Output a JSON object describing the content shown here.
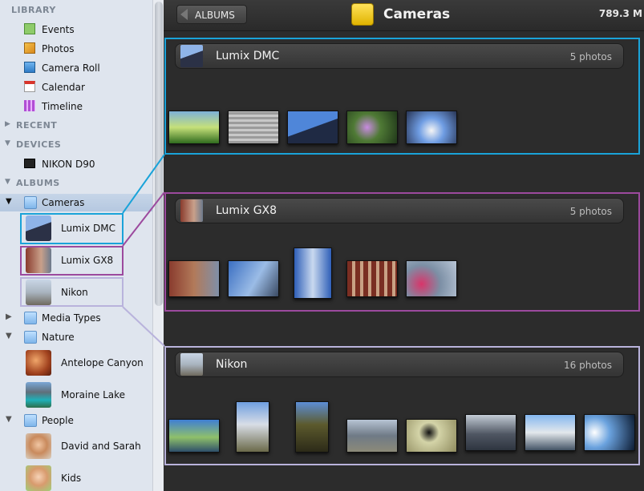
{
  "sidebar": {
    "library_header": "LIBRARY",
    "library_items": [
      {
        "label": "Events",
        "icon": "events-icon"
      },
      {
        "label": "Photos",
        "icon": "photos-icon"
      },
      {
        "label": "Camera Roll",
        "icon": "camera-roll-icon"
      },
      {
        "label": "Calendar",
        "icon": "calendar-icon"
      },
      {
        "label": "Timeline",
        "icon": "timeline-icon"
      }
    ],
    "recent_header": "RECENT",
    "devices_header": "DEVICES",
    "device_item": "NIKON D90",
    "albums_header": "ALBUMS",
    "cameras_folder": "Cameras",
    "camera_albums": [
      "Lumix DMC",
      "Lumix GX8",
      "Nikon"
    ],
    "media_types_folder": "Media Types",
    "nature_folder": "Nature",
    "nature_albums": [
      "Antelope Canyon",
      "Moraine Lake"
    ],
    "people_folder": "People",
    "people_albums": [
      "David and Sarah",
      "Kids"
    ]
  },
  "toolbar": {
    "back_label": "ALBUMS",
    "title": "Cameras",
    "size": "789.3 M"
  },
  "albums": [
    {
      "name": "Lumix DMC",
      "count": "5 photos"
    },
    {
      "name": "Lumix GX8",
      "count": "5 photos"
    },
    {
      "name": "Nikon",
      "count": "16 photos"
    }
  ],
  "colors": {
    "highlight_lumix_dmc": "#1aa3d9",
    "highlight_lumix_gx8": "#9c4a9e",
    "highlight_nikon": "#b9b3dc"
  }
}
